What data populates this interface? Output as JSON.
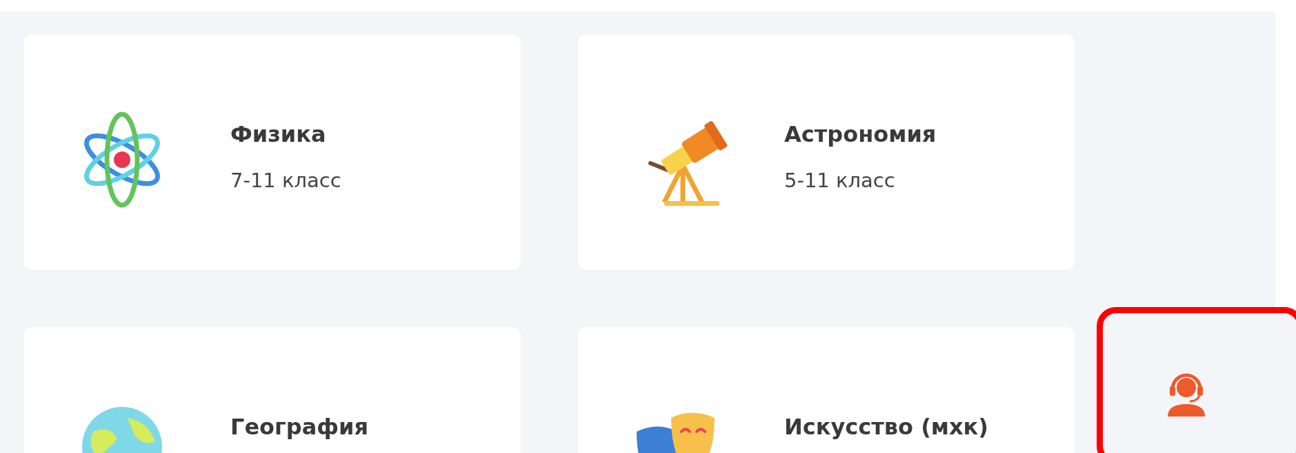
{
  "subjects": [
    {
      "kind": "atom",
      "title": "Физика",
      "grades": "7-11 класс"
    },
    {
      "kind": "telescope",
      "title": "Астрономия",
      "grades": "5-11 класс"
    },
    {
      "kind": "globe",
      "title": "География"
    },
    {
      "kind": "masks",
      "title": "Искусство (мхк)"
    }
  ],
  "support_widget": {
    "highlighted": true
  }
}
